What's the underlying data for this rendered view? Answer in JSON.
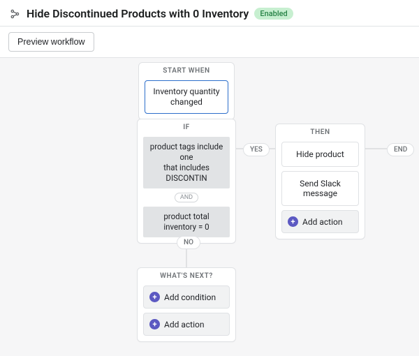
{
  "header": {
    "title": "Hide Discontinued Products with 0 Inventory",
    "status_label": "Enabled"
  },
  "toolbar": {
    "preview_label": "Preview workflow"
  },
  "start_node": {
    "header": "START WHEN",
    "trigger": "Inventory quantity changed"
  },
  "if_node": {
    "header": "IF",
    "condition1": "product tags include one\nthat includes DISCONTIN",
    "and_label": "AND",
    "condition2": "product total inventory = 0"
  },
  "labels": {
    "yes": "YES",
    "no": "NO",
    "end": "END"
  },
  "then_node": {
    "header": "THEN",
    "action1": "Hide product",
    "action2": "Send Slack message",
    "add_action": "Add action"
  },
  "next_node": {
    "header": "WHAT'S NEXT?",
    "add_condition": "Add condition",
    "add_action": "Add action"
  }
}
